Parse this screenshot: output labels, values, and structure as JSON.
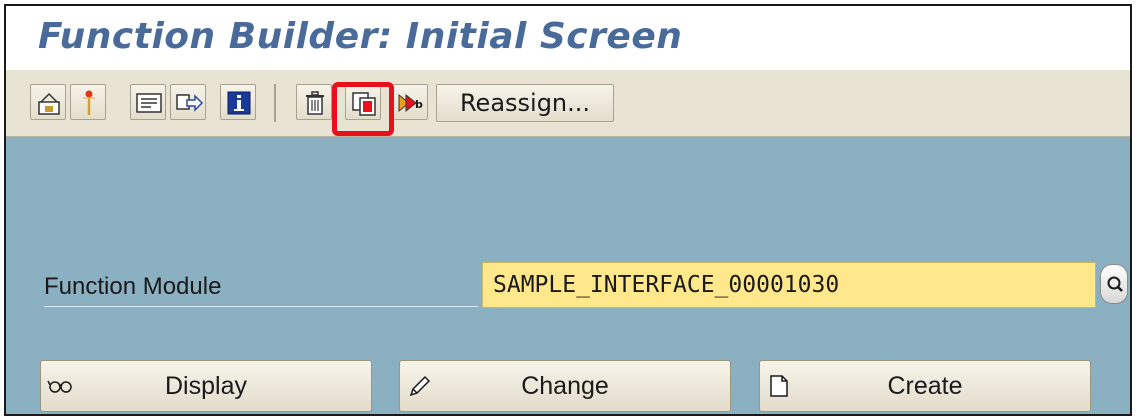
{
  "window": {
    "title": "Function Builder: Initial Screen"
  },
  "toolbar": {
    "icons": [
      "other-object-icon",
      "active-inactive-icon",
      "where-used-icon",
      "display-object-list-icon",
      "info-icon",
      "delete-icon",
      "copy-icon",
      "rename-icon"
    ],
    "reassign_label": "Reassign...",
    "highlighted": "copy-icon",
    "highlight_color": "#e8101a"
  },
  "form": {
    "function_module_label": "Function Module",
    "function_module_value": "SAMPLE_INTERFACE_00001030",
    "value_help_icon": "search-icon",
    "input_background": "#ffe88c"
  },
  "actions": {
    "display_label": "Display",
    "display_icon": "glasses-icon",
    "change_label": "Change",
    "change_icon": "pencil-icon",
    "create_label": "Create",
    "create_icon": "blank-document-icon"
  },
  "colors": {
    "title": "#4a6a9a",
    "toolbar_background": "#e8e3d3",
    "content_background": "#8ab0c2"
  }
}
